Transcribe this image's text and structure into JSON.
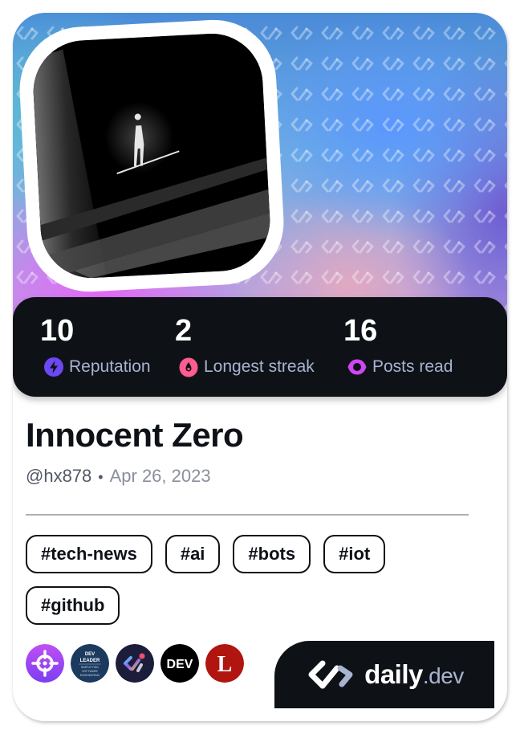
{
  "profile": {
    "name": "Innocent Zero",
    "handle": "@hx878",
    "separator": "•",
    "joined_date": "Apr 26, 2023",
    "avatar_alt": "Silhouette figure standing on a thin line over dark planetary rings"
  },
  "stats": [
    {
      "value": "10",
      "label": "Reputation",
      "icon": "lightning-icon",
      "color": "#6c48f2"
    },
    {
      "value": "2",
      "label": "Longest streak",
      "icon": "flame-icon",
      "color": "#ff5c8f"
    },
    {
      "value": "16",
      "label": "Posts read",
      "icon": "eye-icon",
      "color": "#d046f5"
    }
  ],
  "tags": [
    "#tech-news",
    "#ai",
    "#bots",
    "#iot",
    "#github"
  ],
  "sources": [
    {
      "name": "crosshair-source",
      "bg": "#9b3ff2",
      "text": ""
    },
    {
      "name": "dev-leader-source",
      "bg": "#1b3a5e",
      "text": "DEV LEADER"
    },
    {
      "name": "daily-dev-squad-source",
      "bg": "#1c1d3a",
      "text": ""
    },
    {
      "name": "dev-to-source",
      "bg": "#000000",
      "text": "DEV"
    },
    {
      "name": "l-source",
      "bg": "#b0150f",
      "text": "L"
    }
  ],
  "brand": {
    "name": "daily",
    "tld": ".dev"
  },
  "colors": {
    "dark": "#0e1217",
    "label": "#a8b3cf",
    "handle": "#525866",
    "date": "#8a909b"
  }
}
